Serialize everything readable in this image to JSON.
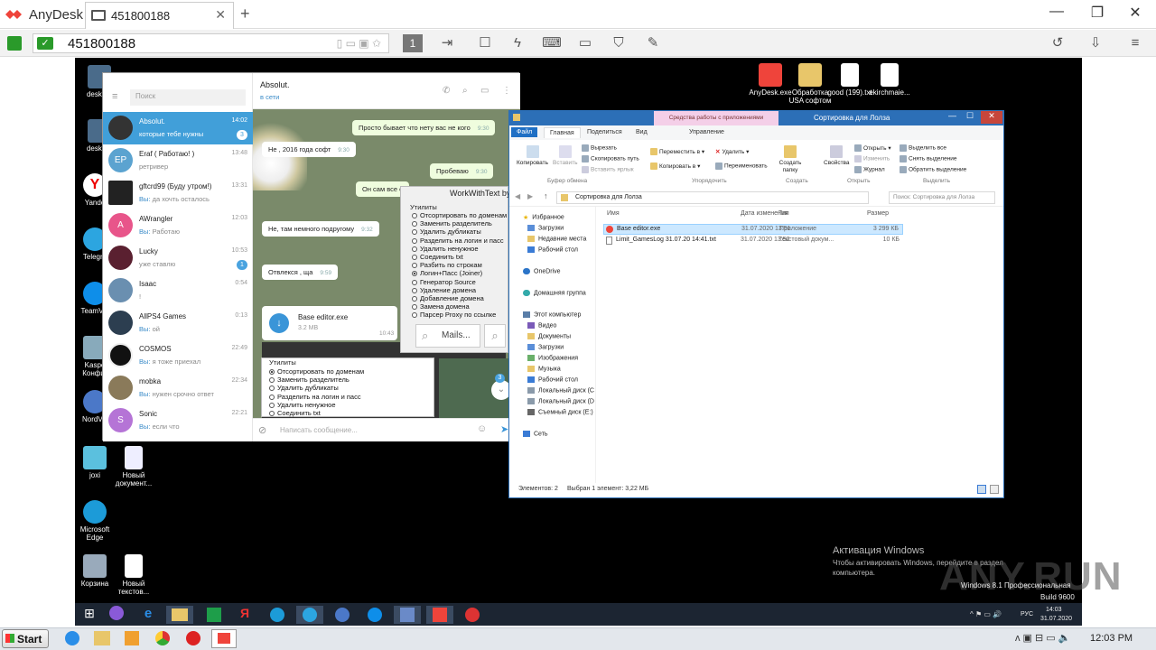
{
  "anydesk": {
    "app_name": "AnyDesk",
    "tab_label": "451800188",
    "address": "451800188",
    "colors": {
      "brand": "#ef443b",
      "connected": "#2a9a2a"
    }
  },
  "desktop": {
    "left_icons": [
      {
        "label": "desktop"
      },
      {
        "label": "desktop"
      },
      {
        "label": "Yande"
      },
      {
        "label": "Telegra"
      },
      {
        "label": "TeamVie"
      },
      {
        "label": "Kaspe Конфиг"
      },
      {
        "label": "NordVP"
      },
      {
        "label": "joxi"
      },
      {
        "label": "Новый документ..."
      },
      {
        "label": "Microsoft Edge"
      },
      {
        "label": "Корзина"
      },
      {
        "label": "Новый текстов..."
      }
    ],
    "top_icons": [
      {
        "label": "AnyDesk.exe"
      },
      {
        "label": "Обработка USA софтом"
      },
      {
        "label": "good (199).txt"
      },
      {
        "label": "ekirchmaie..."
      }
    ],
    "activation_title": "Активация Windows",
    "activation_text": "Чтобы активировать Windows, перейдите в раздел компьютера.",
    "os_build_line1": "Windows 8.1 Профессиональная",
    "os_build_line2": "Build 9600",
    "watermark": "ANY.RUN"
  },
  "telegram": {
    "search_placeholder": "Поиск",
    "chat_title": "Absolut.",
    "chat_status": "в сети",
    "chats": [
      {
        "name": "Absolut.",
        "msg": "которые тебе нужны",
        "time": "14:02",
        "badge": "3",
        "avatar": "",
        "color": "#333"
      },
      {
        "name": "Eraf ( Работаю! )",
        "msg": "ретривер",
        "time": "13:48",
        "badge": "",
        "avatar": "EP",
        "color": "#5ba3d0"
      },
      {
        "name": "gftcrd99 (Буду утром!)",
        "prefix": "Вы:",
        "msg": "да хочть осталось",
        "time": "13:31",
        "badge": "",
        "avatar": "",
        "color": "#222"
      },
      {
        "name": "AWrangler",
        "prefix": "Вы:",
        "msg": "Работаю",
        "time": "12:03",
        "badge": "",
        "avatar": "A",
        "color": "#e8558a"
      },
      {
        "name": "Lucky",
        "msg": "уже ставлю",
        "time": "10:53",
        "badge": "1",
        "avatar": "",
        "color": "#5a2030"
      },
      {
        "name": "Isaac",
        "msg": "!",
        "time": "0:54",
        "badge": "",
        "avatar": "",
        "color": "#6a8fb0"
      },
      {
        "name": "AllPS4 Games",
        "prefix": "Вы:",
        "msg": "ой",
        "time": "0:13",
        "badge": "",
        "avatar": "",
        "color": "#2c3e50"
      },
      {
        "name": "COSMOS",
        "prefix": "Вы:",
        "msg": "я тоже приехал",
        "time": "22:49",
        "badge": "",
        "avatar": "",
        "color": "#111"
      },
      {
        "name": "mobka",
        "prefix": "Вы:",
        "msg": "нужен срочно ответ",
        "time": "22:34",
        "badge": "",
        "avatar": "",
        "color": "#8a7a5a"
      },
      {
        "name": "Sonic",
        "prefix": "Вы:",
        "msg": "если что",
        "time": "22:21",
        "badge": "",
        "avatar": "S",
        "color": "#b574d6"
      }
    ],
    "messages": [
      {
        "text": "Просто бывает что нету вас не кого",
        "time": "9:30",
        "out": true
      },
      {
        "text": "Не , 2016 года софт",
        "time": "9:30",
        "out": false
      },
      {
        "text": "Пробеваю",
        "time": "9:30",
        "out": true
      },
      {
        "text": "Он сам все с",
        "time": "",
        "out": true
      },
      {
        "text": "Не, там немного подругому",
        "time": "9:32",
        "out": false
      },
      {
        "text": "Отвлекся , ща",
        "time": "9:59",
        "out": false
      }
    ],
    "file_name": "Base editor.exe",
    "file_size": "3.2 MB",
    "file_time": "10:43",
    "scroll_badge": "3",
    "input_placeholder": "Написать сообщение..."
  },
  "workwithtext": {
    "title": "WorkWithText by",
    "group_label": "Утилиты",
    "options": [
      "Отсортировать по доменам",
      "Заменить разделитель",
      "Удалить дубликаты",
      "Разделить на логин и пасс",
      "Удалить ненужное",
      "Соединить txt",
      "Разбить по строкам",
      "Логин+Пасс (Joiner)",
      "Генератор Source",
      "Удаление домена",
      "Добавление домена",
      "Замена домена",
      "Парсер Proxy по ссылке"
    ],
    "selected_index": 7,
    "search_label": "Mails...",
    "small_group_label": "Утилиты",
    "small_options": [
      "Отсортировать по доменам",
      "Заменить разделитель",
      "Удалить дубликаты",
      "Разделить на логин и пасс",
      "Удалить ненужное",
      "Соединить txt"
    ],
    "small_selected_index": 0
  },
  "explorer": {
    "title": "Сортировка для Лолза",
    "context_tab": "Средства работы с приложениями",
    "tabs": [
      "Файл",
      "Главная",
      "Поделиться",
      "Вид",
      "Управление"
    ],
    "ribbon": {
      "copy": "Копировать",
      "paste": "Вставить",
      "cut": "Вырезать",
      "copy_path": "Скопировать путь",
      "paste_shortcut": "Вставить ярлык",
      "move_to": "Переместить в",
      "copy_to": "Копировать в",
      "delete": "Удалить",
      "rename": "Переименовать",
      "new_folder": "Создать папку",
      "properties": "Свойства",
      "open": "Открыть",
      "edit": "Изменить",
      "history": "Журнал",
      "select_all": "Выделить все",
      "select_none": "Снять выделение",
      "invert": "Обратить выделение",
      "groups": [
        "Буфер обмена",
        "Упорядочить",
        "Создать",
        "Открыть",
        "Выделить"
      ]
    },
    "path": "Сортировка для Лолза",
    "search_placeholder": "Поиск: Сортировка для Лолза",
    "nav": [
      {
        "label": "Избранное",
        "indent": 0
      },
      {
        "label": "Загрузки",
        "indent": 1
      },
      {
        "label": "Недавние места",
        "indent": 1
      },
      {
        "label": "Рабочий стол",
        "indent": 1
      },
      {
        "label": "OneDrive",
        "indent": 0
      },
      {
        "label": "Домашняя группа",
        "indent": 0
      },
      {
        "label": "Этот компьютер",
        "indent": 0
      },
      {
        "label": "Видео",
        "indent": 1
      },
      {
        "label": "Документы",
        "indent": 1
      },
      {
        "label": "Загрузки",
        "indent": 1
      },
      {
        "label": "Изображения",
        "indent": 1
      },
      {
        "label": "Музыка",
        "indent": 1
      },
      {
        "label": "Рабочий стол",
        "indent": 1
      },
      {
        "label": "Локальный диск (C",
        "indent": 1
      },
      {
        "label": "Локальный диск (D",
        "indent": 1
      },
      {
        "label": "Съемный диск (E:)",
        "indent": 1
      },
      {
        "label": "Сеть",
        "indent": 0
      }
    ],
    "columns": [
      "Имя",
      "Дата изменения",
      "Тип",
      "Размер"
    ],
    "files": [
      {
        "name": "Base editor.exe",
        "date": "31.07.2020 13:51",
        "type": "Приложение",
        "size": "3 299 КБ",
        "selected": true
      },
      {
        "name": "Limit_GamesLog 31.07.20 14:41.txt",
        "date": "31.07.2020 13:52",
        "type": "Текстовый докум...",
        "size": "10 КБ",
        "selected": false
      }
    ],
    "status_items": "Элементов: 2",
    "status_selected": "Выбран 1 элемент: 3,22 МБ"
  },
  "remote_taskbar": {
    "lang": "РУС",
    "time": "14:03",
    "date": "31.07.2020"
  },
  "local_taskbar": {
    "start": "Start",
    "time": "12:03 PM"
  }
}
